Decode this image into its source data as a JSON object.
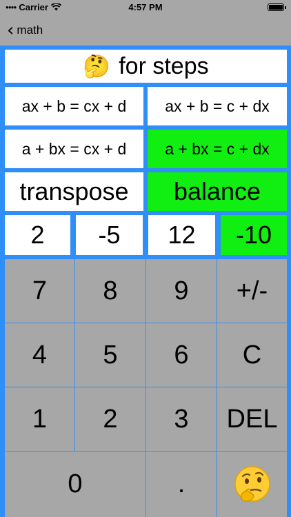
{
  "status_bar": {
    "carrier": "Carrier",
    "time": "4:57 PM"
  },
  "nav": {
    "back_label": "math"
  },
  "steps_button": {
    "emoji": "🤔",
    "label": "for steps"
  },
  "forms": [
    {
      "label": "ax + b = cx + d",
      "selected": false
    },
    {
      "label": "ax + b = c + dx",
      "selected": false
    },
    {
      "label": "a + bx = cx + d",
      "selected": false
    },
    {
      "label": "a + bx = c + dx",
      "selected": true
    }
  ],
  "methods": [
    {
      "label": "transpose",
      "selected": false
    },
    {
      "label": "balance",
      "selected": true
    }
  ],
  "coefficients": [
    {
      "value": "2",
      "selected": false
    },
    {
      "value": "-5",
      "selected": false
    },
    {
      "value": "12",
      "selected": false
    },
    {
      "value": "-10",
      "selected": true
    }
  ],
  "keypad": {
    "keys": [
      "7",
      "8",
      "9",
      "+/-",
      "4",
      "5",
      "6",
      "C",
      "1",
      "2",
      "3",
      "DEL"
    ],
    "zero": "0",
    "dot": ".",
    "think_icon": "thinking-face-icon"
  },
  "colors": {
    "background": "#2f8ef7",
    "selected": "#11ee11",
    "keypad": "#a7a7a7",
    "cell": "#ffffff"
  }
}
